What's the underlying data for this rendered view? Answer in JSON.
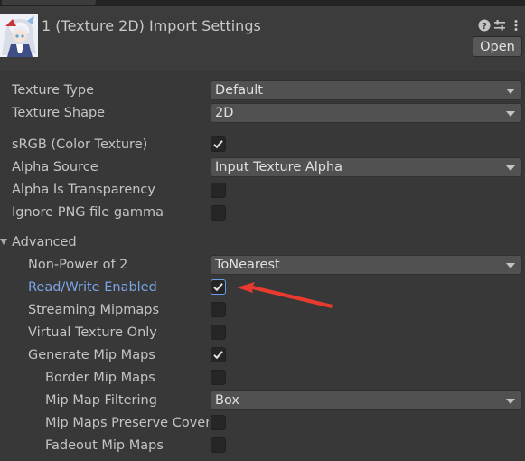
{
  "header": {
    "title": "1 (Texture 2D) Import Settings",
    "open_label": "Open"
  },
  "fields": [
    {
      "label": "Texture Type",
      "type": "dropdown",
      "value": "Default"
    },
    {
      "label": "Texture Shape",
      "type": "dropdown",
      "value": "2D"
    },
    {
      "label": "sRGB (Color Texture)",
      "type": "checkbox",
      "checked": true
    },
    {
      "label": "Alpha Source",
      "type": "dropdown",
      "value": "Input Texture Alpha"
    },
    {
      "label": "Alpha Is Transparency",
      "type": "checkbox",
      "checked": false
    },
    {
      "label": "Ignore PNG file gamma",
      "type": "checkbox",
      "checked": false
    }
  ],
  "advanced": {
    "label": "Advanced",
    "expanded": true,
    "fields": [
      {
        "label": "Non-Power of 2",
        "type": "dropdown",
        "value": "ToNearest"
      },
      {
        "label": "Read/Write Enabled",
        "type": "checkbox",
        "checked": true,
        "highlighted": true
      },
      {
        "label": "Streaming Mipmaps",
        "type": "checkbox",
        "checked": false
      },
      {
        "label": "Virtual Texture Only",
        "type": "checkbox",
        "checked": false
      },
      {
        "label": "Generate Mip Maps",
        "type": "checkbox",
        "checked": true
      },
      {
        "label": "Border Mip Maps",
        "type": "checkbox",
        "checked": false
      },
      {
        "label": "Mip Map Filtering",
        "type": "dropdown",
        "value": "Box"
      },
      {
        "label": "Mip Maps Preserve Coverage",
        "type": "checkbox",
        "checked": false
      },
      {
        "label": "Fadeout Mip Maps",
        "type": "checkbox",
        "checked": false
      }
    ]
  },
  "colors": {
    "background": "#383838",
    "highlight_label": "#7ba4e6",
    "annotation_arrow": "#e83a2e"
  }
}
